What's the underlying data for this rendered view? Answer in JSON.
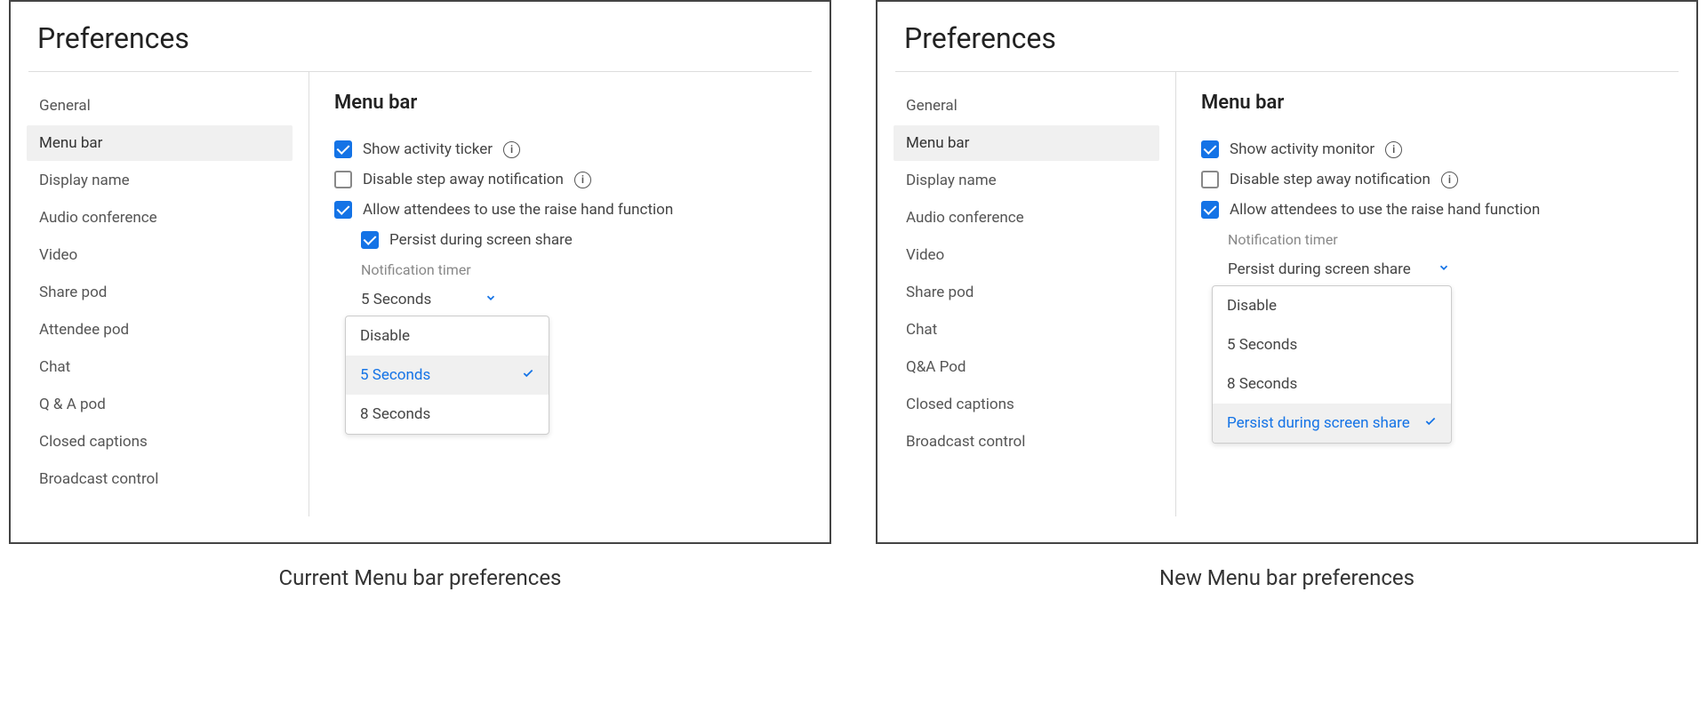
{
  "left": {
    "title": "Preferences",
    "sidebar": [
      "General",
      "Menu bar",
      "Display name",
      "Audio conference",
      "Video",
      "Share pod",
      "Attendee pod",
      "Chat",
      "Q & A pod",
      "Closed captions",
      "Broadcast control"
    ],
    "selected_index": 1,
    "main_title": "Menu bar",
    "opt1": "Show activity ticker",
    "opt2": "Disable step away notification",
    "opt3": "Allow attendees to use the raise hand function",
    "opt4": "Persist during screen share",
    "timer_label": "Notification timer",
    "timer_value": "5 Seconds",
    "dropdown": [
      "Disable",
      "5 Seconds",
      "8 Seconds"
    ],
    "dropdown_selected": 1,
    "caption": "Current Menu bar preferences"
  },
  "right": {
    "title": "Preferences",
    "sidebar": [
      "General",
      "Menu bar",
      "Display name",
      "Audio conference",
      "Video",
      "Share pod",
      "Chat",
      "Q&A Pod",
      "Closed captions",
      "Broadcast control"
    ],
    "selected_index": 1,
    "main_title": "Menu bar",
    "opt1": "Show activity monitor",
    "opt2": "Disable step away notification",
    "opt3": "Allow attendees to use the raise hand function",
    "timer_label": "Notification timer",
    "timer_value": "Persist during screen share",
    "dropdown": [
      "Disable",
      "5 Seconds",
      "8 Seconds",
      "Persist during screen share"
    ],
    "dropdown_selected": 3,
    "caption": "New Menu bar preferences"
  }
}
